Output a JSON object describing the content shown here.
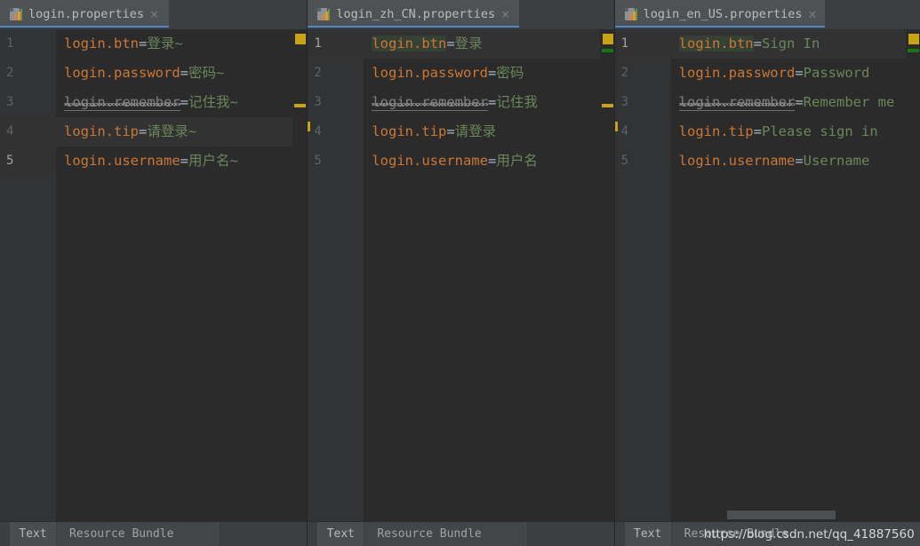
{
  "panels": [
    {
      "tab": {
        "title": "login.properties",
        "close": "×",
        "icon": "properties-file-icon"
      },
      "current_line": 5,
      "lines": [
        {
          "num": "1",
          "key": "login.btn",
          "eq": "=",
          "value": "登录~",
          "unused": false
        },
        {
          "num": "2",
          "key": "login.password",
          "eq": "=",
          "value": "密码~",
          "unused": false
        },
        {
          "num": "3",
          "key": "login.remember",
          "eq": "=",
          "value": "记住我~",
          "unused": true
        },
        {
          "num": "4",
          "key": "login.tip",
          "eq": "=",
          "value": "请登录~",
          "unused": false
        },
        {
          "num": "5",
          "key": "login.username",
          "eq": "=",
          "value": "用户名~",
          "unused": false
        }
      ],
      "status": {
        "text_tab": "Text",
        "bundle_tab": "Resource Bundle"
      }
    },
    {
      "tab": {
        "title": "login_zh_CN.properties",
        "close": "×",
        "icon": "properties-file-icon"
      },
      "current_line": 1,
      "lines": [
        {
          "num": "1",
          "key": "login.btn",
          "eq": "=",
          "value": "登录",
          "unused": false
        },
        {
          "num": "2",
          "key": "login.password",
          "eq": "=",
          "value": "密码",
          "unused": false
        },
        {
          "num": "3",
          "key": "login.remember",
          "eq": "=",
          "value": "记住我",
          "unused": true
        },
        {
          "num": "4",
          "key": "login.tip",
          "eq": "=",
          "value": "请登录",
          "unused": false
        },
        {
          "num": "5",
          "key": "login.username",
          "eq": "=",
          "value": "用户名",
          "unused": false
        }
      ],
      "status": {
        "text_tab": "Text",
        "bundle_tab": "Resource Bundle"
      }
    },
    {
      "tab": {
        "title": "login_en_US.properties",
        "close": "×",
        "icon": "properties-file-icon"
      },
      "current_line": 1,
      "lines": [
        {
          "num": "1",
          "key": "login.btn",
          "eq": "=",
          "value": "Sign In",
          "unused": false
        },
        {
          "num": "2",
          "key": "login.password",
          "eq": "=",
          "value": "Password",
          "unused": false
        },
        {
          "num": "3",
          "key": "login.remember",
          "eq": "=",
          "value": "Remember me",
          "unused": true
        },
        {
          "num": "4",
          "key": "login.tip",
          "eq": "=",
          "value": "Please sign in",
          "unused": false
        },
        {
          "num": "5",
          "key": "login.username",
          "eq": "=",
          "value": "Username",
          "unused": false
        }
      ],
      "status": {
        "text_tab": "Text",
        "bundle_tab": "Resource Bundle"
      }
    }
  ],
  "watermark": "https://blog.csdn.net/qq_41887560",
  "colors": {
    "key": "#cc7832",
    "value": "#6a8759",
    "equals": "#a9b7c6",
    "unused_key": "#808080",
    "editor_bg": "#2b2b2b",
    "gutter_bg": "#313335",
    "chrome_bg": "#3c3f41",
    "tab_active_bg": "#4e5254",
    "tab_underline": "#4a88c7",
    "warning_marker": "#c9a313",
    "ok_marker": "#127a12",
    "selection": "#344134"
  }
}
